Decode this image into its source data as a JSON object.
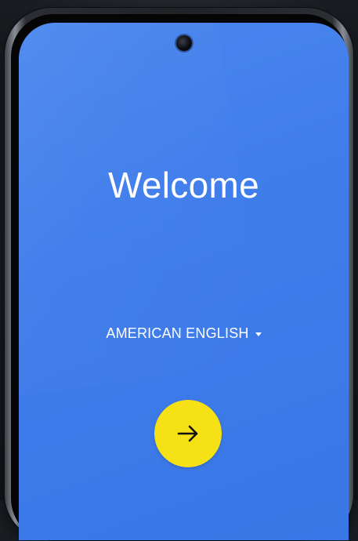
{
  "welcome": {
    "title": "Welcome"
  },
  "language": {
    "selected": "AMERICAN ENGLISH"
  },
  "next_button": {
    "icon": "arrow-right-icon",
    "color": "#f6e116"
  },
  "theme": {
    "screen_background": "#3f7deb"
  }
}
